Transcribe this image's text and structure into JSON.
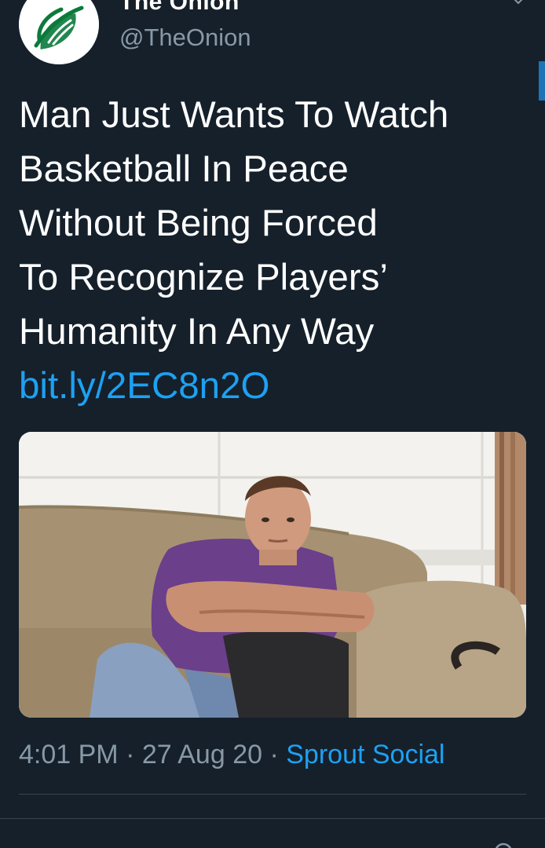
{
  "tweet": {
    "display_name": "The Onion",
    "handle": "@TheOnion",
    "text_lines": [
      "Man Just Wants To Watch",
      "Basketball In Peace",
      "Without Being Forced",
      "To Recognize Players’",
      "Humanity In Any Way"
    ],
    "link": "bit.ly/2EC8n2O",
    "media_icon": "photo-man-on-couch",
    "time": "4:01 PM",
    "separator": "·",
    "date": "27 Aug 20",
    "source": "Sprout Social"
  },
  "colors": {
    "background": "#15202b",
    "link": "#1da1f2",
    "secondary_text": "#8899a6",
    "onion_green": "#0b7a3b"
  }
}
